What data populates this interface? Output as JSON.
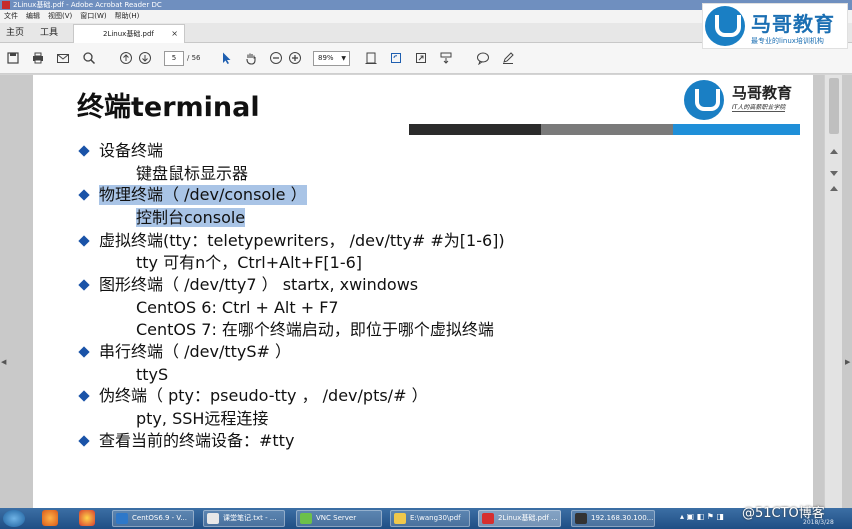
{
  "window": {
    "title": "2Linux基础.pdf - Adobe Acrobat Reader DC"
  },
  "menu": [
    "文件",
    "编辑",
    "视图(V)",
    "窗口(W)",
    "帮助(H)"
  ],
  "nav": {
    "home": "主页",
    "tools": "工具"
  },
  "tab": {
    "label": "2Linux基础.pdf",
    "close": "×"
  },
  "toolbar": {
    "page_current": "5",
    "page_total": "/ 56",
    "zoom": "89%"
  },
  "brand": {
    "name": "马哥教育",
    "slogan": "最专业的linux培训机构"
  },
  "slide": {
    "title": "终端terminal",
    "logo_name": "马哥教育",
    "logo_slogan": "IT人的高薪职业学院",
    "lines": [
      {
        "kind": "bullet",
        "text": "设备终端"
      },
      {
        "kind": "indent",
        "text": "键盘鼠标显示器"
      },
      {
        "kind": "bullet",
        "text": "物理终端（ /dev/console ）",
        "highlight": true
      },
      {
        "kind": "indent",
        "text": "控制台console",
        "highlight": true
      },
      {
        "kind": "bullet",
        "text": "虚拟终端(tty：teletypewriters， /dev/tty#  #为[1-6])"
      },
      {
        "kind": "indent",
        "text": "tty 可有n个，Ctrl+Alt+F[1-6]"
      },
      {
        "kind": "bullet",
        "text": "图形终端（ /dev/tty7 ） startx, xwindows"
      },
      {
        "kind": "indent",
        "text": "CentOS 6: Ctrl + Alt + F7"
      },
      {
        "kind": "indent",
        "text": "CentOS 7: 在哪个终端启动，即位于哪个虚拟终端"
      },
      {
        "kind": "bullet",
        "text": "串行终端（ /dev/ttyS# ）"
      },
      {
        "kind": "indent",
        "text": "ttyS"
      },
      {
        "kind": "bullet",
        "text": "伪终端（ pty：pseudo-tty ， /dev/pts/# ）"
      },
      {
        "kind": "indent",
        "text": "pty, SSH远程连接"
      },
      {
        "kind": "bullet",
        "text": "查看当前的终端设备：#tty"
      }
    ]
  },
  "taskbar": {
    "tasks": [
      "CentOS6.9 - V...",
      "课堂笔记.txt - ...",
      "VNC Server",
      "E:\\wang30\\pdf",
      "2Linux基础.pdf ...",
      "192.168.30.100..."
    ],
    "tray": "@51CTO博客",
    "date": "2018/3/28"
  }
}
